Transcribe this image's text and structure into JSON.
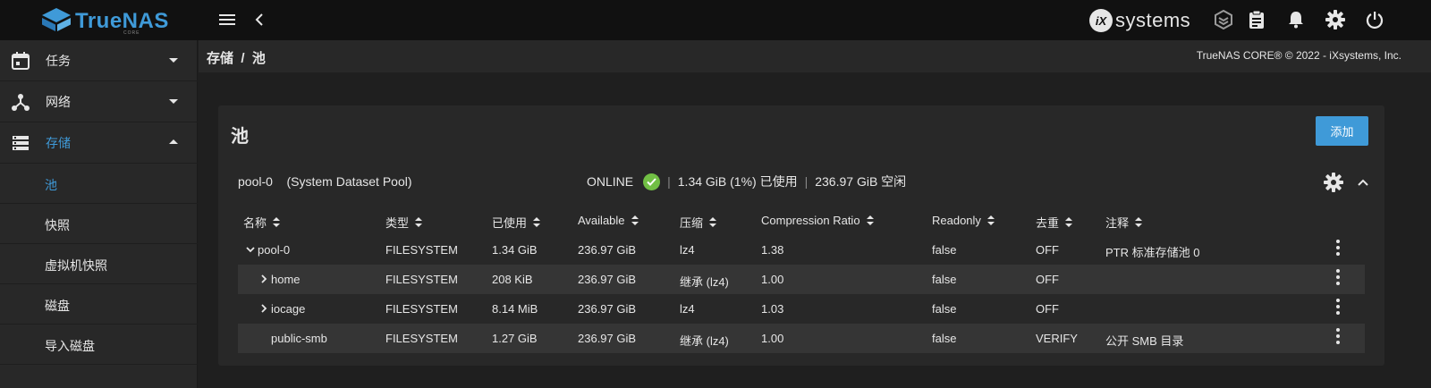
{
  "brand": {
    "name": "TrueNAS",
    "edition": "CORE",
    "vendor_mark": "iX",
    "vendor_name": "systems",
    "accent_color": "#3f9ad8"
  },
  "topbar": {
    "icons": [
      "menu-icon",
      "back-icon",
      "truecommand-icon",
      "tasks-icon",
      "notifications-icon",
      "settings-icon",
      "power-icon"
    ]
  },
  "sidebar": {
    "items": [
      {
        "label": "任务",
        "icon": "calendar-icon",
        "expanded": false
      },
      {
        "label": "网络",
        "icon": "network-icon",
        "expanded": false
      },
      {
        "label": "存储",
        "icon": "storage-icon",
        "expanded": true,
        "active": true
      }
    ],
    "storage_children": [
      {
        "label": "池",
        "active": true
      },
      {
        "label": "快照"
      },
      {
        "label": "虚拟机快照"
      },
      {
        "label": "磁盘"
      },
      {
        "label": "导入磁盘"
      }
    ]
  },
  "breadcrumb": {
    "text": "存储  /  池"
  },
  "copyright": "TrueNAS CORE® © 2022 - iXsystems, Inc.",
  "card": {
    "title": "池",
    "add_label": "添加"
  },
  "pool": {
    "name": "pool-0    (System Dataset Pool)",
    "status": "ONLINE",
    "used": "1.34 GiB (1%) 已使用",
    "free": "236.97 GiB 空闲",
    "status_color": "#71bf44"
  },
  "table": {
    "columns": [
      "名称",
      "类型",
      "已使用",
      "Available",
      "压缩",
      "Compression Ratio",
      "Readonly",
      "去重",
      "注释"
    ],
    "rows": [
      {
        "name": "pool-0",
        "type": "FILESYSTEM",
        "used": "1.34 GiB",
        "available": "236.97 GiB",
        "compression": "lz4",
        "ratio": "1.38",
        "readonly": "false",
        "dedup": "OFF",
        "comment": "PTR 标准存储池 0"
      },
      {
        "name": "home",
        "type": "FILESYSTEM",
        "used": "208 KiB",
        "available": "236.97 GiB",
        "compression": "继承 (lz4)",
        "ratio": "1.00",
        "readonly": "false",
        "dedup": "OFF",
        "comment": ""
      },
      {
        "name": "iocage",
        "type": "FILESYSTEM",
        "used": "8.14 MiB",
        "available": "236.97 GiB",
        "compression": "lz4",
        "ratio": "1.03",
        "readonly": "false",
        "dedup": "OFF",
        "comment": ""
      },
      {
        "name": "public-smb",
        "type": "FILESYSTEM",
        "used": "1.27 GiB",
        "available": "236.97 GiB",
        "compression": "继承 (lz4)",
        "ratio": "1.00",
        "readonly": "false",
        "dedup": "VERIFY",
        "comment": "公开 SMB 目录"
      }
    ]
  }
}
